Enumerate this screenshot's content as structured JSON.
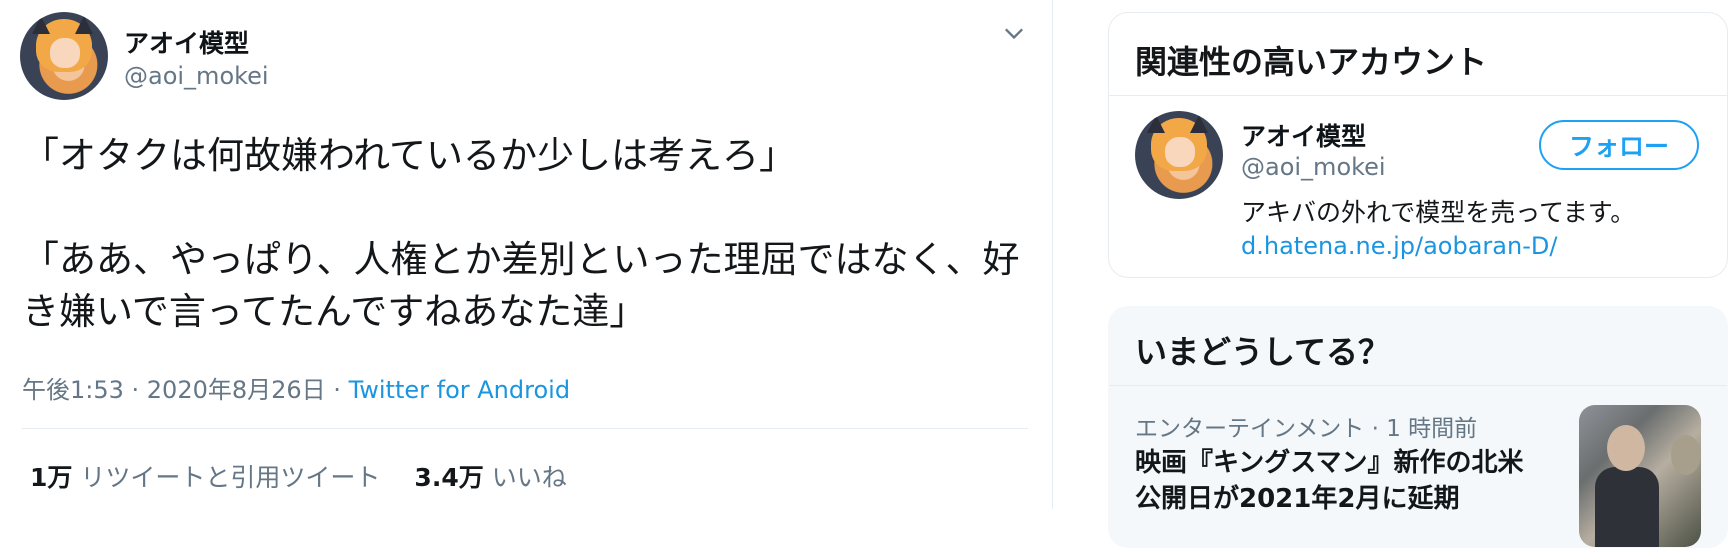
{
  "tweet": {
    "author": {
      "display_name": "アオイ模型",
      "handle": "@aoi_mokei"
    },
    "text": "「オタクは何故嫌われているか少しは考えろ」\n\n「ああ、やっぱり、人権とか差別といった理屈ではなく、好き嫌いで言ってたんですねあなた達」",
    "timestamp": "午後1:53 · 2020年8月26日 · ",
    "source": "Twitter for Android",
    "stats": {
      "retweets_count": "1万",
      "retweets_label": "リツイートと引用ツイート",
      "likes_count": "3.4万",
      "likes_label": "いいね"
    },
    "menu_icon": "chevron-down-icon"
  },
  "sidebar": {
    "related": {
      "title": "関連性の高いアカウント",
      "account": {
        "display_name": "アオイ模型",
        "handle": "@aoi_mokei",
        "follow_label": "フォロー",
        "bio": "アキバの外れで模型を売ってます。",
        "link": "d.hatena.ne.jp/aobaran-D/"
      }
    },
    "trends": {
      "title": "いまどうしてる？",
      "item": {
        "meta": "エンターテインメント · 1 時間前",
        "headline": "映画『キングスマン』新作の北米\n公開日が2021年2月に延期"
      }
    }
  },
  "colors": {
    "accent": "#1da1f2",
    "link": "#1b95e0",
    "muted": "#657786",
    "border": "#e6ecf0"
  }
}
